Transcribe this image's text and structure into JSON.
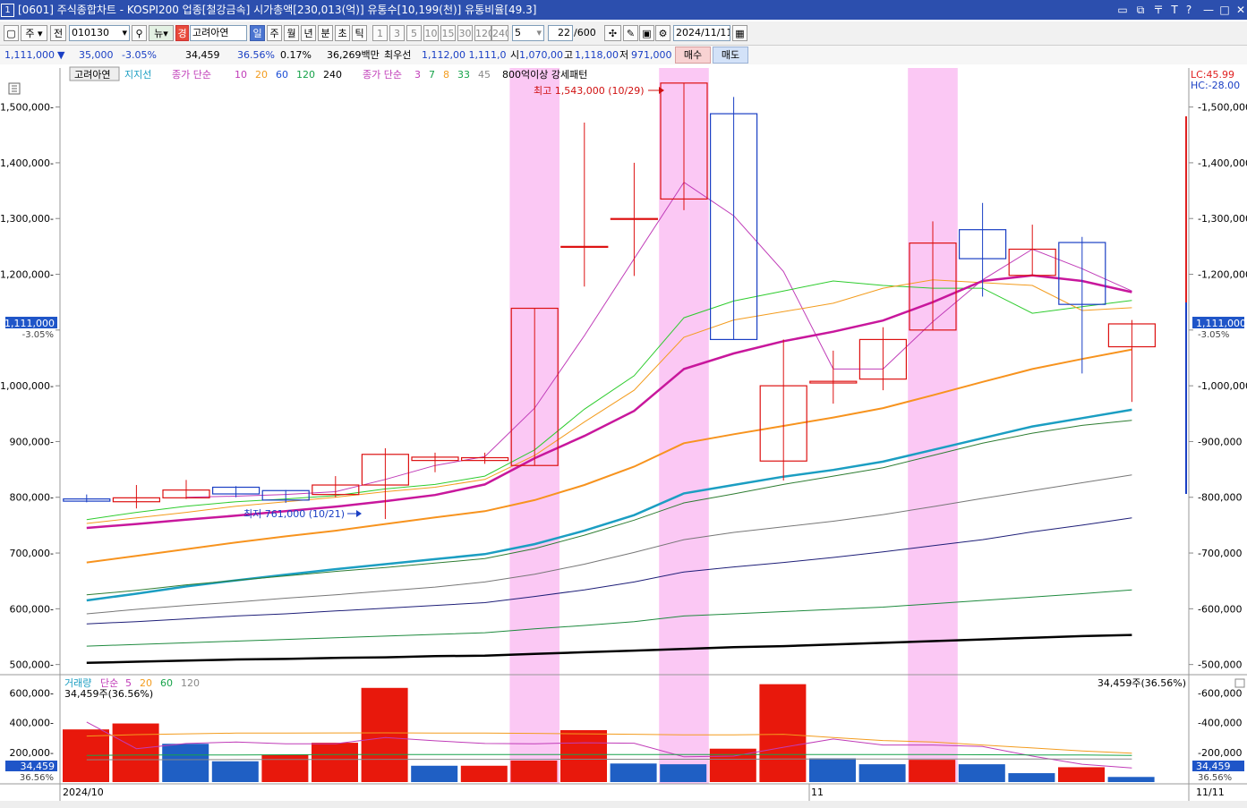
{
  "window": {
    "number": "1",
    "title": "[0601] 주식종합차트 - KOSPI200 업종[철강금속] 시가총액[230,013(억)] 유통수[10,199(천)] 유통비율[49.3]"
  },
  "toolbar": {
    "market_select": "주",
    "all_label": "전",
    "stock_code": "010130",
    "news_label": "뉴",
    "type_badge": "경",
    "stock_name": "고려아연",
    "periods": [
      "일",
      "주",
      "월",
      "년",
      "분",
      "초",
      "틱"
    ],
    "active_period": "일",
    "intervals": [
      "1",
      "3",
      "5",
      "10",
      "15",
      "30",
      "120",
      "240"
    ],
    "interval_value": "5",
    "count_value": "22",
    "count_total": "/600",
    "date_value": "2024/11/11"
  },
  "info": {
    "price": "1,111,000",
    "change_arrow": "▼",
    "change": "35,000",
    "change_pct": "-3.05%",
    "volume": "34,459",
    "vol_ratio": "36.56%",
    "turnover": "0.17%",
    "amount": "36,269백만",
    "prio_label": "최우선",
    "prio_values": "1,112,00 1,111,0",
    "open_label": "시",
    "open": "1,070,00",
    "high_label": "고",
    "high": "1,118,00",
    "low_label": "저",
    "low": "971,000",
    "buy_label": "매수",
    "sell_label": "매도"
  },
  "legend": {
    "stock": "고려아연",
    "support": "지지선",
    "ma1_label": "종가 단순",
    "ma1_periods": [
      {
        "p": "10",
        "color": "#c03cb8"
      },
      {
        "p": "20",
        "color": "#f39c1e"
      },
      {
        "p": "60",
        "color": "#1d4fd6"
      },
      {
        "p": "120",
        "color": "#17a34a"
      },
      {
        "p": "240",
        "color": "#000000"
      }
    ],
    "ma2_label": "종가 단순",
    "ma2_periods": [
      {
        "p": "3",
        "color": "#c03cb8"
      },
      {
        "p": "7",
        "color": "#17a34a"
      },
      {
        "p": "8",
        "color": "#f39c1e"
      },
      {
        "p": "33",
        "color": "#17a34a"
      },
      {
        "p": "45",
        "color": "#888888"
      }
    ],
    "pattern": "800억이상 강세패턴",
    "lc": "LC:45.99",
    "hc": "HC:-28.00"
  },
  "annotations": {
    "high": "최고 1,543,000 (10/29)",
    "low": "최저 761,000 (10/21)",
    "price_tag": "1,111,000",
    "pct_tag": "-3.05%"
  },
  "volume_panel": {
    "title": "거래량",
    "ma_label": "단순",
    "ma_periods": [
      {
        "p": "5",
        "color": "#c03cb8"
      },
      {
        "p": "20",
        "color": "#f39c1e"
      },
      {
        "p": "60",
        "color": "#17a34a"
      },
      {
        "p": "120",
        "color": "#888888"
      }
    ],
    "sub": "34,459주(36.56%)",
    "right_label": "34,459주(36.56%)",
    "tag_value": "34,459",
    "tag_pct": "36.56%"
  },
  "xaxis": {
    "left": "2024/10",
    "mid": "11",
    "right": "11/11"
  },
  "chart_data": {
    "type": "candlestick",
    "y_ticks": [
      500000,
      600000,
      700000,
      800000,
      900000,
      1000000,
      1100000,
      1200000,
      1300000,
      1400000,
      1500000
    ],
    "y_tick_labels": [
      "500,000",
      "600,000",
      "700,000",
      "800,000",
      "900,000",
      "1,000,000",
      "1,200,000",
      "1,300,000",
      "1,400,000",
      "1,500,000"
    ],
    "ylim": [
      485000,
      1570000
    ],
    "candles": [
      {
        "o": 797000,
        "h": 805000,
        "l": 791000,
        "c": 793000
      },
      {
        "o": 792000,
        "h": 822000,
        "l": 780000,
        "c": 799000
      },
      {
        "o": 799000,
        "h": 831000,
        "l": 797000,
        "c": 813000
      },
      {
        "o": 818000,
        "h": 820000,
        "l": 800000,
        "c": 806000
      },
      {
        "o": 812000,
        "h": 813000,
        "l": 790000,
        "c": 795000
      },
      {
        "o": 805000,
        "h": 838000,
        "l": 800000,
        "c": 822000
      },
      {
        "o": 822000,
        "h": 888000,
        "l": 761000,
        "c": 877000
      },
      {
        "o": 866000,
        "h": 880000,
        "l": 845000,
        "c": 872000
      },
      {
        "o": 866000,
        "h": 880000,
        "l": 860000,
        "c": 871000
      },
      {
        "o": 857000,
        "h": 1139000,
        "l": 857000,
        "c": 1139000
      },
      {
        "o": 1250000,
        "h": 1472000,
        "l": 1178000,
        "c": 1250000
      },
      {
        "o": 1300000,
        "h": 1400000,
        "l": 1197000,
        "c": 1300000
      },
      {
        "o": 1335000,
        "h": 1543000,
        "l": 1315000,
        "c": 1543000
      },
      {
        "o": 1488000,
        "h": 1518000,
        "l": 1083000,
        "c": 1083000
      },
      {
        "o": 865000,
        "h": 1083000,
        "l": 830000,
        "c": 1000000
      },
      {
        "o": 1005000,
        "h": 1063000,
        "l": 968000,
        "c": 1008000
      },
      {
        "o": 1012000,
        "h": 1105000,
        "l": 992000,
        "c": 1083000
      },
      {
        "o": 1100000,
        "h": 1295000,
        "l": 1100000,
        "c": 1256000
      },
      {
        "o": 1280000,
        "h": 1328000,
        "l": 1160000,
        "c": 1228000
      },
      {
        "o": 1198000,
        "h": 1289000,
        "l": 1198000,
        "c": 1245000
      },
      {
        "o": 1257000,
        "h": 1267000,
        "l": 1022000,
        "c": 1146000
      },
      {
        "o": 1070000,
        "h": 1118000,
        "l": 971000,
        "c": 1111000
      }
    ],
    "highlight_bars": [
      9,
      12,
      17
    ],
    "moving_averages": [
      {
        "name": "ma3",
        "color": "#c03cb8",
        "width": 1,
        "values": [
          null,
          null,
          800000,
          802000,
          805000,
          810000,
          832000,
          857000,
          873000,
          960000,
          1090000,
          1228000,
          1365000,
          1305000,
          1205000,
          1030000,
          1030000,
          1115000,
          1190000,
          1245000,
          1210000,
          1170000
        ]
      },
      {
        "name": "ma7",
        "color": "#2ecc2e",
        "width": 1,
        "values": [
          760000,
          773000,
          784000,
          792000,
          797000,
          803000,
          815000,
          823000,
          838000,
          885000,
          958000,
          1018000,
          1122000,
          1152000,
          1170000,
          1188000,
          1180000,
          1175000,
          1175000,
          1130000,
          1142000,
          1153000
        ]
      },
      {
        "name": "ma8",
        "color": "#f39c1e",
        "width": 1,
        "values": [
          753000,
          763000,
          773000,
          784000,
          792000,
          800000,
          810000,
          818000,
          832000,
          875000,
          935000,
          992000,
          1087000,
          1118000,
          1133000,
          1148000,
          1175000,
          1190000,
          1185000,
          1180000,
          1135000,
          1140000
        ]
      },
      {
        "name": "ma10",
        "color": "#c8179c",
        "width": 2.5,
        "values": [
          745000,
          752000,
          760000,
          767000,
          775000,
          783000,
          793000,
          804000,
          823000,
          870000,
          910000,
          955000,
          1030000,
          1058000,
          1080000,
          1097000,
          1117000,
          1150000,
          1188000,
          1198000,
          1188000,
          1168000
        ]
      },
      {
        "name": "ma20",
        "color": "#f7931e",
        "width": 2,
        "values": [
          683000,
          695000,
          707000,
          719000,
          730000,
          740000,
          752000,
          764000,
          775000,
          795000,
          822000,
          855000,
          897000,
          913000,
          928000,
          943000,
          960000,
          983000,
          1007000,
          1030000,
          1048000,
          1065000
        ]
      },
      {
        "name": "ma60",
        "color": "#1b9ec2",
        "width": 2.5,
        "values": [
          615000,
          627000,
          640000,
          651000,
          661000,
          671000,
          680000,
          689000,
          698000,
          716000,
          740000,
          768000,
          807000,
          822000,
          837000,
          849000,
          864000,
          885000,
          906000,
          927000,
          942000,
          957000
        ]
      },
      {
        "name": "ma33",
        "color": "#2e7d32",
        "width": 1,
        "values": [
          625000,
          633000,
          643000,
          651000,
          659000,
          667000,
          674000,
          682000,
          690000,
          708000,
          732000,
          759000,
          790000,
          806000,
          823000,
          838000,
          853000,
          875000,
          897000,
          915000,
          929000,
          938000
        ]
      },
      {
        "name": "ma45",
        "color": "#777777",
        "width": 1,
        "values": [
          591000,
          599000,
          606000,
          612000,
          619000,
          625000,
          632000,
          639000,
          648000,
          662000,
          680000,
          701000,
          724000,
          737000,
          747000,
          757000,
          769000,
          783000,
          798000,
          812000,
          826000,
          840000
        ]
      },
      {
        "name": "ma120",
        "color": "#1e1e78",
        "width": 1,
        "values": [
          573000,
          577000,
          582000,
          587000,
          591000,
          596000,
          601000,
          606000,
          611000,
          622000,
          634000,
          648000,
          666000,
          675000,
          683000,
          692000,
          702000,
          713000,
          724000,
          738000,
          750000,
          763000
        ]
      },
      {
        "name": "ma240",
        "color": "#1e8a3e",
        "width": 1,
        "values": [
          533000,
          536000,
          539000,
          542000,
          545000,
          548000,
          551000,
          554000,
          557000,
          564000,
          570000,
          577000,
          587000,
          591000,
          595000,
          599000,
          603000,
          609000,
          615000,
          621000,
          627000,
          634000
        ]
      },
      {
        "name": "ma_long",
        "color": "#000000",
        "width": 2.5,
        "values": [
          503000,
          505000,
          507000,
          509000,
          510000,
          512000,
          513000,
          515000,
          516000,
          519000,
          522000,
          525000,
          528000,
          531000,
          533000,
          536000,
          539000,
          542000,
          545000,
          548000,
          551000,
          553000
        ]
      }
    ],
    "volume": {
      "ylim": [
        0,
        700000
      ],
      "y_ticks": [
        200000,
        400000,
        600000
      ],
      "y_tick_labels": [
        "200,000",
        "400,000",
        "600,000"
      ],
      "values": [
        355000,
        395000,
        258000,
        140000,
        185000,
        265000,
        635000,
        110000,
        110000,
        145000,
        350000,
        125000,
        120000,
        225000,
        660000,
        160000,
        120000,
        150000,
        120000,
        60000,
        100000,
        34459
      ],
      "up": [
        true,
        true,
        false,
        false,
        true,
        true,
        true,
        false,
        true,
        true,
        true,
        false,
        false,
        true,
        true,
        false,
        false,
        true,
        false,
        false,
        true,
        false
      ],
      "ma5": [
        405000,
        225000,
        260000,
        270000,
        258000,
        258000,
        300000,
        278000,
        260000,
        258000,
        265000,
        262000,
        170000,
        175000,
        235000,
        290000,
        250000,
        250000,
        240000,
        175000,
        120000,
        95000
      ],
      "ma20": [
        310000,
        320000,
        325000,
        330000,
        330000,
        331000,
        332000,
        330000,
        330000,
        328000,
        325000,
        322000,
        318000,
        318000,
        322000,
        300000,
        280000,
        270000,
        250000,
        230000,
        210000,
        195000
      ],
      "ma60": [
        180000,
        182000,
        183000,
        183000,
        184000,
        185000,
        185000,
        185000,
        185000,
        185000,
        185000,
        186000,
        186000,
        186000,
        186000,
        186000,
        186000,
        185000,
        184000,
        183000,
        182000,
        180000
      ],
      "ma120": [
        150000,
        151000,
        151000,
        152000,
        152000,
        152000,
        153000,
        153000,
        153000,
        153000,
        154000,
        154000,
        154000,
        154000,
        155000,
        155000,
        155000,
        155000,
        155000,
        155000,
        155000,
        155000
      ]
    }
  }
}
